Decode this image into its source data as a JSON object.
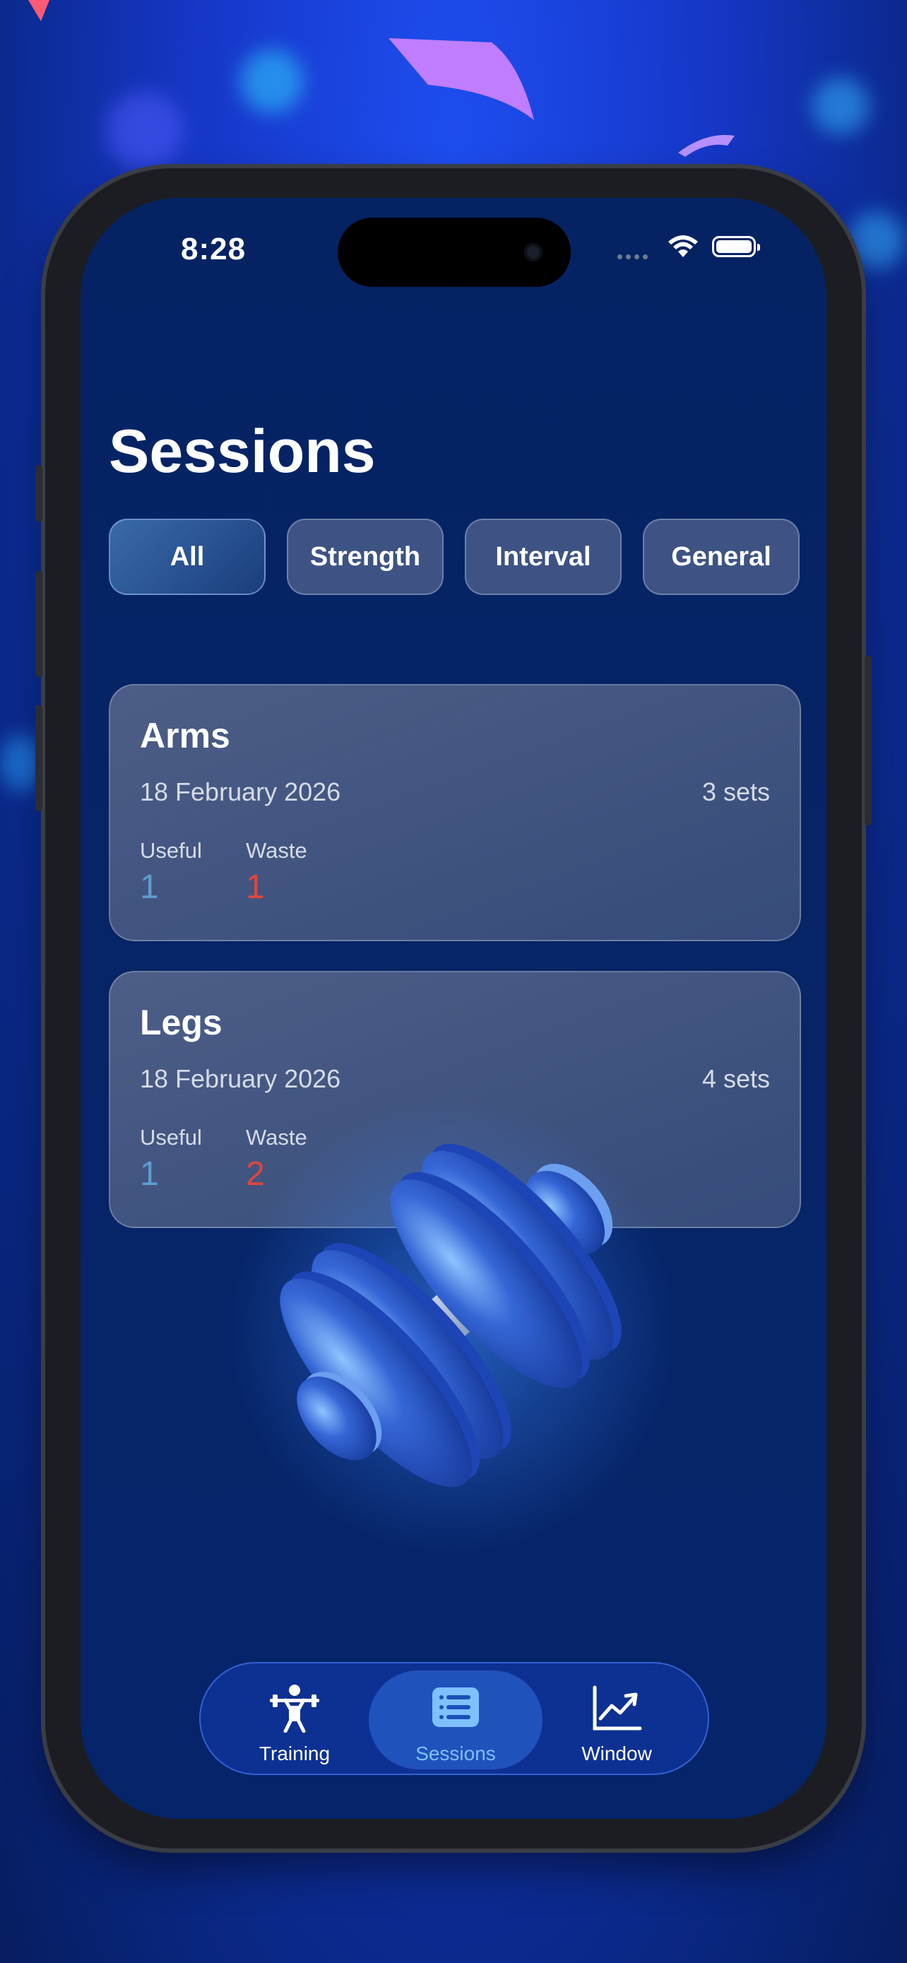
{
  "status": {
    "time": "8:28"
  },
  "page": {
    "title": "Sessions"
  },
  "filters": [
    {
      "label": "All",
      "active": true
    },
    {
      "label": "Strength",
      "active": false
    },
    {
      "label": "Interval",
      "active": false
    },
    {
      "label": "General",
      "active": false
    }
  ],
  "sessions": [
    {
      "name": "Arms",
      "date": "18 February 2026",
      "sets": "3 sets",
      "useful_label": "Useful",
      "useful": "1",
      "waste_label": "Waste",
      "waste": "1"
    },
    {
      "name": "Legs",
      "date": "18 February 2026",
      "sets": "4 sets",
      "useful_label": "Useful",
      "useful": "1",
      "waste_label": "Waste",
      "waste": "2"
    }
  ],
  "tabbar": {
    "selected": "Sessions",
    "tabs": [
      {
        "label": "Training",
        "icon": "weightlifter-icon"
      },
      {
        "label": "Sessions",
        "icon": "list-icon"
      },
      {
        "label": "Window",
        "icon": "chart-trend-icon"
      }
    ]
  },
  "colors": {
    "accent": "#7fc0ff",
    "useful": "#5f9bd1",
    "waste": "#e0463c"
  }
}
